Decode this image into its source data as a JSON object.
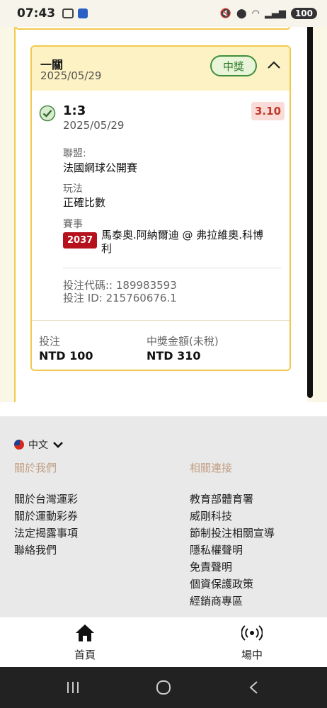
{
  "status_bar": {
    "time": "07:43",
    "battery": "100"
  },
  "bet": {
    "title": "一關",
    "date": "2025/05/29",
    "status_badge": "中獎",
    "selection": {
      "score": "1:3",
      "date": "2025/05/29",
      "odds": "3.10",
      "league_label": "聯盟:",
      "league_value": "法國網球公開賽",
      "market_label": "玩法",
      "market_value": "正確比數",
      "event_label": "賽事",
      "event_number": "2037",
      "event_name": "馬泰奧.阿納爾迪 @ 弗拉維奧.科博利",
      "bet_code": "投注代碼:: 189983593",
      "bet_id": "投注 ID: 215760676.1"
    },
    "stake_label": "投注",
    "stake_value": "NTD 100",
    "payout_label": "中獎金額(未稅)",
    "payout_value": "NTD 310"
  },
  "footer": {
    "language": "中文",
    "about_heading": "關於我們",
    "about_links": [
      "關於台灣運彩",
      "關於運動彩券",
      "法定揭露事項",
      "聯絡我們"
    ],
    "related_heading": "相關連接",
    "related_links": [
      "教育部體育署",
      "威剛科技",
      "節制投注相關宣導",
      "隱私權聲明",
      "免責聲明",
      "個資保護政策",
      "經銷商專區"
    ]
  },
  "bottom_nav": {
    "home": "首頁",
    "live": "場中"
  }
}
